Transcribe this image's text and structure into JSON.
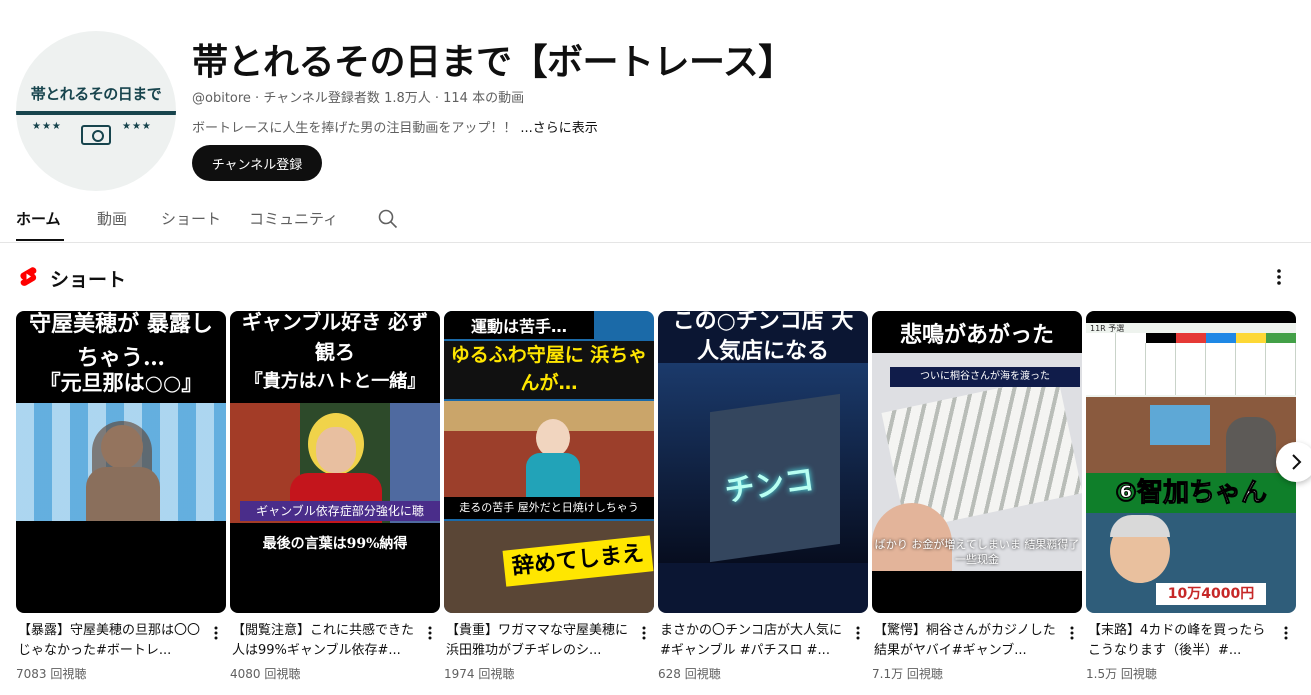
{
  "channel": {
    "avatar_text": "帯とれるその日まで",
    "avatar_stars": "★★★",
    "name": "帯とれるその日まで【ボートレース】",
    "meta": "@obitore · チャンネル登録者数 1.8万人 · 114 本の動画",
    "description": "ボートレースに人生を捧げた男の注目動画をアップ！！",
    "more_label": "...さらに表示",
    "subscribe_label": "チャンネル登録"
  },
  "tabs": [
    {
      "label": "ホーム",
      "active": true
    },
    {
      "label": "動画",
      "active": false
    },
    {
      "label": "ショート",
      "active": false
    },
    {
      "label": "コミュニティ",
      "active": false
    }
  ],
  "section": {
    "title": "ショート"
  },
  "shorts": [
    {
      "title": "【暴露】守屋美穂の旦那は〇〇じゃなかった#ボートレ...",
      "views": "7083 回視聴",
      "thumb_top": "守屋美穂が 暴露しちゃう…",
      "thumb_mid": "『元旦那は○○』"
    },
    {
      "title": "【閲覧注意】これに共感できた人は99%ギャンブル依存#...",
      "views": "4080 回視聴",
      "thumb_top": "ギャンブル好き 必ず観ろ",
      "thumb_mid": "『貴方はハトと一緒』",
      "thumb_band": "ギャンブル依存症部分強化に聴",
      "thumb_bottom": "最後の言葉は99%納得"
    },
    {
      "title": "【貴重】ワガママな守屋美穂に浜田雅功がブチギレのシ...",
      "views": "1974 回視聴",
      "thumb_top": "運動は苦手…",
      "thumb_mid": "ゆるふわ守屋に 浜ちゃんが…",
      "thumb_band": "走るの苦手 屋外だと日焼けしちゃう",
      "thumb_bottom": "辞めてしまえ"
    },
    {
      "title": "まさかの〇チンコ店が大人気に#ギャンブル #パチスロ #...",
      "views": "628 回視聴",
      "thumb_top": "この○チンコ店 大人気店になる",
      "thumb_sign": "チンコ"
    },
    {
      "title": "【驚愕】桐谷さんがカジノした結果がヤバイ#ギャンブ...",
      "views": "7.1万 回視聴",
      "thumb_top": "悲鳴があがった",
      "thumb_band": "ついに桐谷さんが海を渡った",
      "thumb_bottom": "ばかり お金が増えてしまいま 結果覇得了一些现金"
    },
    {
      "title": "【末路】4カドの峰を買ったらこうなります（後半）#...",
      "views": "1.5万 回視聴",
      "thumb_top": "11R 予選",
      "thumb_mid": "⑥智加ちゃん",
      "thumb_bottom": "10万4000円"
    }
  ],
  "colors": {
    "shorts_red": "#ff0000",
    "avatar_teal": "#17444d",
    "secondary_text": "#606060"
  }
}
